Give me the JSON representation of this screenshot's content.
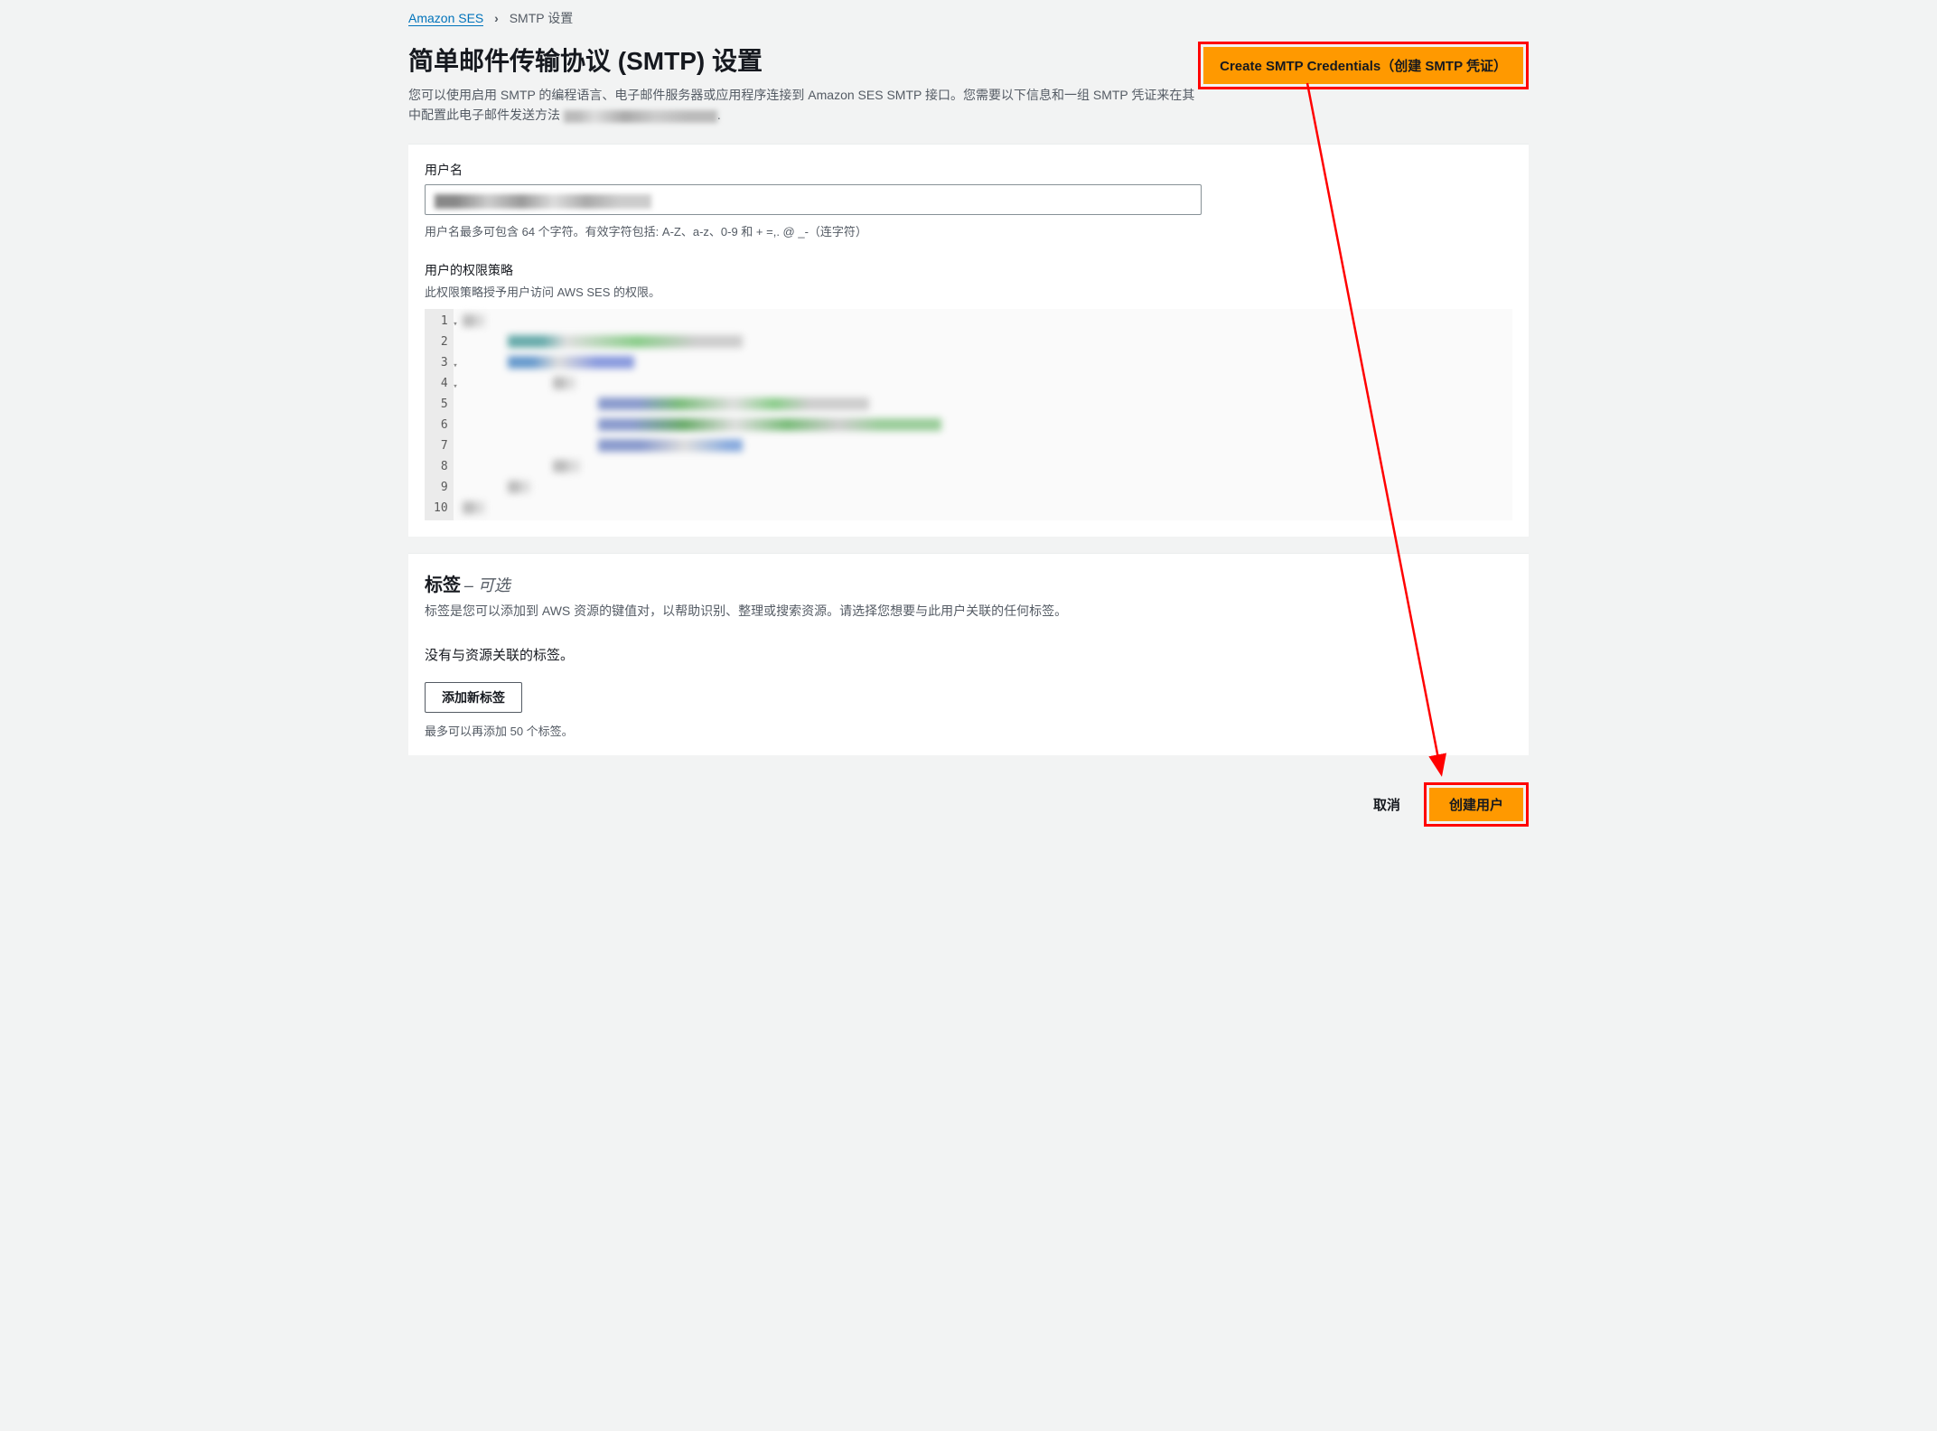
{
  "breadcrumb": {
    "root": "Amazon SES",
    "current": "SMTP 设置"
  },
  "header": {
    "title": "简单邮件传输协议 (SMTP) 设置",
    "description": "您可以使用启用 SMTP 的编程语言、电子邮件服务器或应用程序连接到 Amazon SES SMTP 接口。您需要以下信息和一组 SMTP 凭证来在其中配置此电子邮件发送方法",
    "create_button": "Create SMTP Credentials（创建 SMTP 凭证）"
  },
  "form": {
    "username_label": "用户名",
    "username_value": "",
    "username_help": "用户名最多可包含 64 个字符。有效字符包括: A-Z、a-z、0-9 和 + =,. @ _-（连字符）",
    "policy_title": "用户的权限策略",
    "policy_sub": "此权限策略授予用户访问 AWS SES 的权限。",
    "policy_lines": [
      "1",
      "2",
      "3",
      "4",
      "5",
      "6",
      "7",
      "8",
      "9",
      "10"
    ]
  },
  "tags": {
    "title": "标签",
    "optional": "– 可选",
    "desc": "标签是您可以添加到 AWS 资源的键值对，以帮助识别、整理或搜索资源。请选择您想要与此用户关联的任何标签。",
    "none": "没有与资源关联的标签。",
    "add_button": "添加新标签",
    "limit": "最多可以再添加 50 个标签。"
  },
  "footer": {
    "cancel": "取消",
    "create": "创建用户"
  }
}
